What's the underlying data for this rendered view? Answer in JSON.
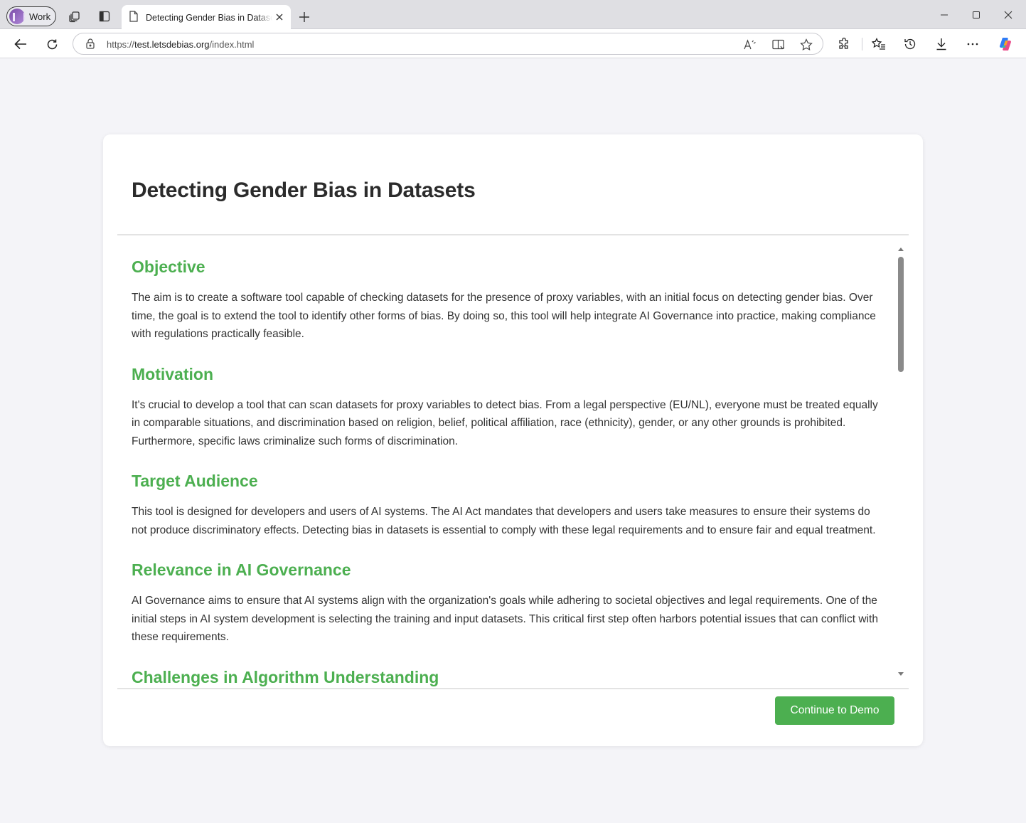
{
  "browser": {
    "profile_label": "Work",
    "tab_title": "Detecting Gender Bias in Datasets",
    "url_scheme": "https://",
    "url_host": "test.letsdebias.org",
    "url_path": "/index.html",
    "icons": [
      "workspaces-icon",
      "tab-actions-icon",
      "page-icon",
      "close-icon",
      "new-tab-icon",
      "minimize-icon",
      "maximize-icon",
      "window-close-icon",
      "back-icon",
      "refresh-icon",
      "lock-icon",
      "read-aloud-icon",
      "immersive-reader-icon",
      "favorite-star-icon",
      "extensions-icon",
      "favorites-icon",
      "history-icon",
      "downloads-icon",
      "more-icon",
      "copilot-icon"
    ]
  },
  "page": {
    "title": "Detecting Gender Bias in Datasets",
    "sections": [
      {
        "heading": "Objective",
        "text": "The aim is to create a software tool capable of checking datasets for the presence of proxy variables, with an initial focus on detecting gender bias. Over time, the goal is to extend the tool to identify other forms of bias. By doing so, this tool will help integrate AI Governance into practice, making compliance with regulations practically feasible."
      },
      {
        "heading": "Motivation",
        "text": "It's crucial to develop a tool that can scan datasets for proxy variables to detect bias. From a legal perspective (EU/NL), everyone must be treated equally in comparable situations, and discrimination based on religion, belief, political affiliation, race (ethnicity), gender, or any other grounds is prohibited. Furthermore, specific laws criminalize such forms of discrimination."
      },
      {
        "heading": "Target Audience",
        "text": "This tool is designed for developers and users of AI systems. The AI Act mandates that developers and users take measures to ensure their systems do not produce discriminatory effects. Detecting bias in datasets is essential to comply with these legal requirements and to ensure fair and equal treatment."
      },
      {
        "heading": "Relevance in AI Governance",
        "text": "AI Governance aims to ensure that AI systems align with the organization's goals while adhering to societal objectives and legal requirements. One of the initial steps in AI system development is selecting the training and input datasets. This critical first step often harbors potential issues that can conflict with these requirements."
      },
      {
        "heading": "Challenges in Algorithm Understanding",
        "text": ""
      }
    ],
    "button_label": "Continue to Demo",
    "colors": {
      "accent": "#4caf50",
      "background": "#f4f4f8",
      "card": "#ffffff",
      "heading": "#2b2b2b"
    }
  }
}
